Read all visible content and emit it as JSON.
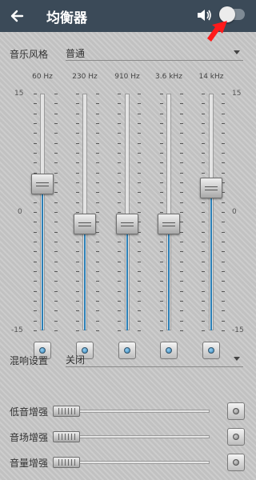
{
  "header": {
    "title": "均衡器",
    "back_icon": "arrow-left-icon",
    "volume_icon": "speaker-icon",
    "toggle_on": false,
    "accent": "#3b4a58",
    "pointer_color": "#ff1a1a"
  },
  "preset": {
    "label": "音乐风格",
    "value": "普通"
  },
  "equalizer": {
    "scale_top": "15",
    "scale_mid": "0",
    "scale_bottom": "-15",
    "range": [
      -15,
      15
    ],
    "bands": [
      {
        "freq": "60 Hz",
        "gain": 3.5
      },
      {
        "freq": "230 Hz",
        "gain": -1.5
      },
      {
        "freq": "910 Hz",
        "gain": -1.5
      },
      {
        "freq": "3.6 kHz",
        "gain": -1.5
      },
      {
        "freq": "14 kHz",
        "gain": 3.0
      }
    ],
    "fill_color": "#2a7fb6"
  },
  "reverb": {
    "label": "混响设置",
    "value": "关闭"
  },
  "effects": [
    {
      "label": "低音增强",
      "level": 0
    },
    {
      "label": "音场增强",
      "level": 0
    },
    {
      "label": "音量增强",
      "level": 0
    }
  ]
}
